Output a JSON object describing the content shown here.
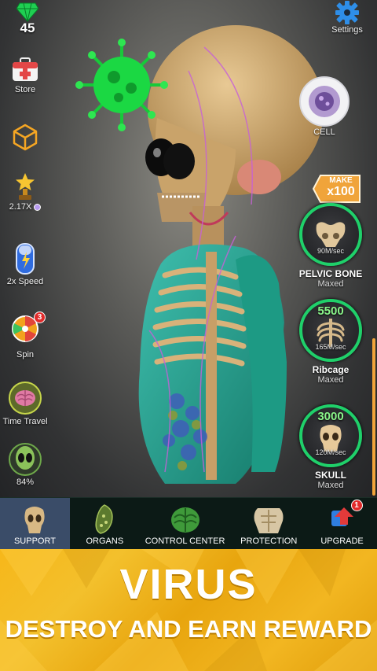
{
  "hud": {
    "gems": "45",
    "settings_label": "Settings"
  },
  "left_menu": {
    "store": "Store",
    "multiplier": "2.17X",
    "speed": "2x Speed",
    "spin": "Spin",
    "spin_badge": "3",
    "time_travel": "Time Travel",
    "progress": "84%"
  },
  "cell": {
    "label": "CELL"
  },
  "make_button": {
    "line1": "MAKE",
    "line2": "x100"
  },
  "upgrades": [
    {
      "name": "PELVIC BONE",
      "status": "Maxed",
      "cost": "",
      "rate": "90M/sec"
    },
    {
      "name": "Ribcage",
      "status": "Maxed",
      "cost": "5500",
      "rate": "165M/sec"
    },
    {
      "name": "SKULL",
      "status": "Maxed",
      "cost": "3000",
      "rate": "120M/sec"
    }
  ],
  "nav": {
    "tabs": [
      {
        "label": "SUPPORT"
      },
      {
        "label": "ORGANS"
      },
      {
        "label": "CONTROL CENTER"
      },
      {
        "label": "PROTECTION"
      },
      {
        "label": "UPGRADE",
        "badge": "1"
      }
    ]
  },
  "banner": {
    "title": "VIRUS",
    "subtitle": "DESTROY AND EARN REWARD"
  },
  "colors": {
    "accent_green": "#1fd06a",
    "banner_yellow": "#f3b81f",
    "nav_bg": "#0c1a16",
    "nav_active": "#3a4c68",
    "make_orange": "#f0a43a"
  }
}
